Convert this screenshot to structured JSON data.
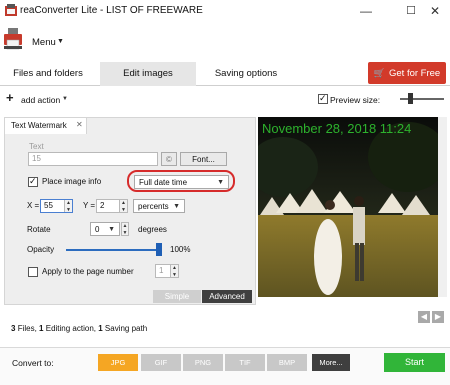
{
  "window": {
    "title": "reaConverter Lite - LIST OF FREEWARE",
    "minimize_glyph": "—",
    "maximize_glyph": "☐",
    "close_glyph": "✕"
  },
  "menu": {
    "label": "Menu"
  },
  "tabs": [
    {
      "label": "Files and folders"
    },
    {
      "label": "Edit images"
    },
    {
      "label": "Saving options"
    }
  ],
  "get_for_free": {
    "label": "Get for Free",
    "color": "#d23a2a"
  },
  "toolbar": {
    "add_action": "add action",
    "preview_size_label": "Preview size:",
    "preview_size_checked": true
  },
  "panel": {
    "tab_label": "Text Watermark",
    "text_label": "Text",
    "text_value": "15",
    "copyright_glyph": "©",
    "font_button": "Font...",
    "place_image_info_label": "Place image info",
    "place_image_info_checked": true,
    "image_info_value": "Full date time",
    "x_label": "X =",
    "x_value": "55",
    "y_label": "Y =",
    "y_value": "2",
    "units_value": "percents",
    "rotate_label": "Rotate",
    "rotate_value": "0",
    "rotate_unit": "degrees",
    "opacity_label": "Opacity",
    "opacity_value": "100%",
    "opacity_fraction": 1.0,
    "apply_page_label": "Apply to the page number",
    "apply_page_value": "1",
    "mode_simple": "Simple",
    "mode_advanced": "Advanced"
  },
  "preview": {
    "watermark_text": "November 28, 2018 11:24",
    "watermark_color": "#2db22d"
  },
  "status": {
    "files_count": "3",
    "files_label": "Files,",
    "editing_count": "1",
    "editing_label": "Editing action,",
    "saving_count": "1",
    "saving_label": "Saving path"
  },
  "bottom": {
    "convert_to_label": "Convert to:",
    "formats": [
      {
        "label": "JPG",
        "active": true
      },
      {
        "label": "GIF",
        "active": false
      },
      {
        "label": "PNG",
        "active": false
      },
      {
        "label": "TIF",
        "active": false
      },
      {
        "label": "BMP",
        "active": false
      },
      {
        "label": "More...",
        "active": false
      }
    ],
    "start_label": "Start",
    "accent_active": "#f5a623",
    "start_color": "#31b539"
  }
}
